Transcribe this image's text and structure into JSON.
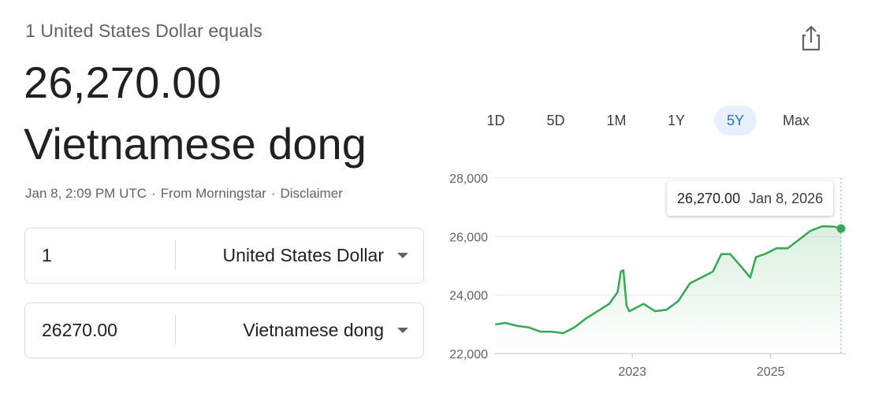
{
  "header": {
    "subtitle": "1 United States Dollar equals",
    "value": "26,270.00",
    "currency_name": "Vietnamese dong"
  },
  "meta": {
    "timestamp": "Jan 8, 2:09 PM UTC",
    "separator": "·",
    "source": "From Morningstar",
    "disclaimer": "Disclaimer"
  },
  "converter": {
    "from": {
      "amount": "1",
      "currency": "United States Dollar"
    },
    "to": {
      "amount": "26270.00",
      "currency": "Vietnamese dong"
    }
  },
  "range_tabs": [
    {
      "label": "1D",
      "active": false
    },
    {
      "label": "5D",
      "active": false
    },
    {
      "label": "1M",
      "active": false
    },
    {
      "label": "1Y",
      "active": false
    },
    {
      "label": "5Y",
      "active": true
    },
    {
      "label": "Max",
      "active": false
    }
  ],
  "share": {
    "icon": "share-icon"
  },
  "tooltip": {
    "value": "26,270.00",
    "date": "Jan 8, 2026"
  },
  "colors": {
    "line": "#34a853",
    "active_tab_text": "#1a73e8",
    "active_tab_bg": "#e8f0fe",
    "text_secondary": "#5f6368"
  },
  "chart_data": {
    "type": "line",
    "ylim": [
      22000,
      28000
    ],
    "y_ticks": [
      "28,000",
      "26,000",
      "24,000",
      "22,000"
    ],
    "y_tick_values": [
      28000,
      26000,
      24000,
      22000
    ],
    "x_ticks": [
      "2023",
      "2025"
    ],
    "x_tick_values": [
      "2023-01-01",
      "2025-01-01"
    ],
    "grid": true,
    "series": [
      {
        "x": [
          "2021-01-11",
          "2021-03-01",
          "2021-05-01",
          "2021-07-01",
          "2021-09-01",
          "2021-11-01",
          "2022-01-01",
          "2022-03-01",
          "2022-05-01",
          "2022-07-01",
          "2022-09-01",
          "2022-10-15",
          "2022-11-01",
          "2022-11-15",
          "2022-12-01",
          "2022-12-15",
          "2023-01-01",
          "2023-03-01",
          "2023-05-01",
          "2023-07-01",
          "2023-09-01",
          "2023-11-01",
          "2024-01-01",
          "2024-03-01",
          "2024-04-15",
          "2024-06-01",
          "2024-08-01",
          "2024-09-15",
          "2024-10-15",
          "2024-12-01",
          "2025-02-01",
          "2025-04-01",
          "2025-06-01",
          "2025-08-01",
          "2025-10-01",
          "2025-12-01",
          "2026-01-08"
        ],
        "y": [
          23000,
          23050,
          22950,
          22900,
          22750,
          22750,
          22700,
          22900,
          23200,
          23450,
          23700,
          24100,
          24800,
          24850,
          23650,
          23450,
          23500,
          23700,
          23450,
          23500,
          23800,
          24400,
          24600,
          24800,
          25400,
          25400,
          24950,
          24600,
          25300,
          25400,
          25600,
          25600,
          25900,
          26200,
          26350,
          26340,
          26270
        ]
      }
    ]
  }
}
